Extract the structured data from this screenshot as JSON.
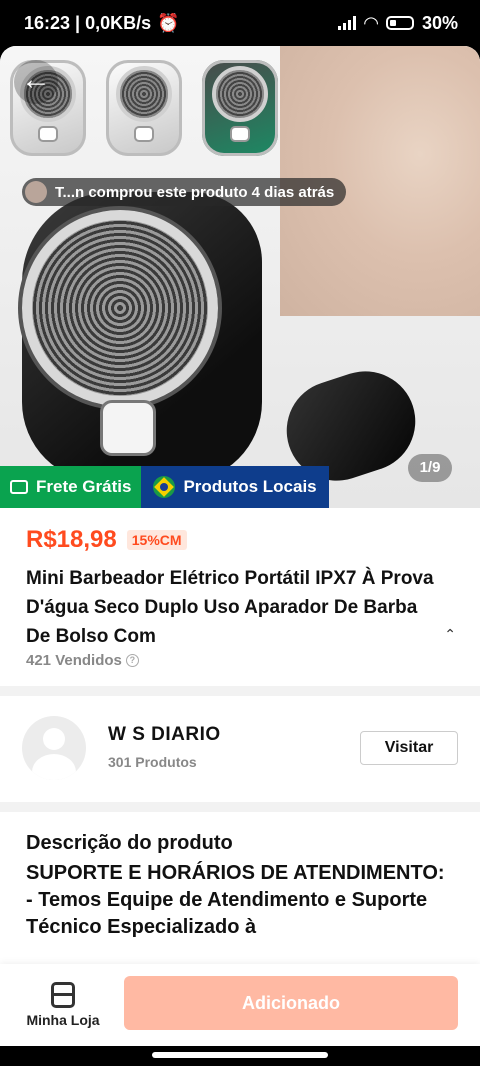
{
  "status_bar": {
    "time_speed": "16:23 | 0,0KB/s",
    "battery": "30%"
  },
  "hero": {
    "purchase_toast": "T...n comprou este produto 4 dias atrás",
    "image_counter": "1/9",
    "badge_free_shipping": "Frete Grátis",
    "badge_local_products": "Produtos Locais"
  },
  "product": {
    "price": "R$18,98",
    "discount": "15%CM",
    "title": "Mini Barbeador Elétrico Portátil IPX7 À Prova D'água Seco Duplo Uso Aparador De Barba De Bolso Com",
    "sold": "421 Vendidos"
  },
  "store": {
    "name": "W S DIARIO",
    "product_count": "301 Produtos",
    "visit_label": "Visitar"
  },
  "description": {
    "title": "Descrição do produto",
    "body": "SUPORTE E HORÁRIOS DE ATENDIMENTO:\n- Temos Equipe de Atendimento e Suporte Técnico Especializado à"
  },
  "bottom_bar": {
    "shop_label": "Minha Loja",
    "add_label": "Adicionado"
  },
  "colors": {
    "price": "#ff4b1f",
    "free_shipping": "#0aa34f",
    "local_products": "#0e3d8c",
    "add_button_disabled": "#ffb9a3"
  }
}
